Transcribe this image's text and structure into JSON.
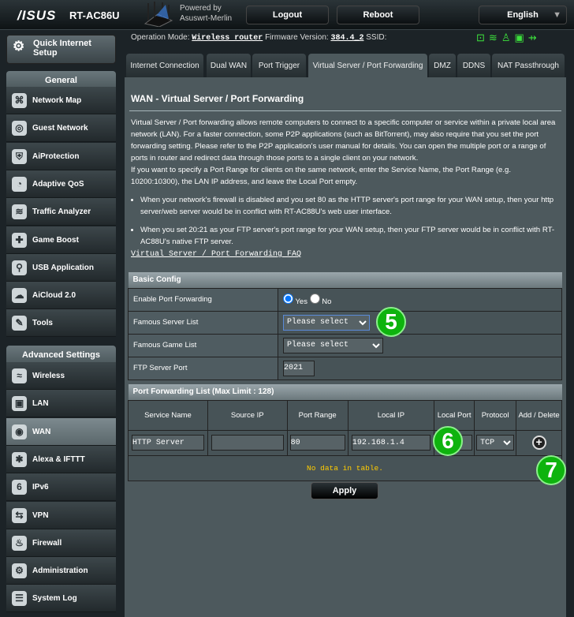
{
  "header": {
    "brand": "/ISUS",
    "model": "RT-AC86U",
    "powered_by": "Powered by",
    "firmware_brand": "Asuswrt-Merlin",
    "logout": "Logout",
    "reboot": "Reboot",
    "language": "English"
  },
  "status_bar": {
    "op_mode_label": "Operation Mode:",
    "op_mode": "Wireless router",
    "fw_label": "Firmware Version:",
    "fw": "384.4_2",
    "ssid_label": "SSID:",
    "icons": [
      "gamepad-icon",
      "wifi-icon",
      "user-icon",
      "device-icon",
      "usb-icon"
    ]
  },
  "sidebar": {
    "quick_setup": "Quick Internet Setup",
    "general": "General",
    "general_items": [
      {
        "label": "Network Map",
        "icon": "⌘"
      },
      {
        "label": "Guest Network",
        "icon": "◎"
      },
      {
        "label": "AiProtection",
        "icon": "⛨"
      },
      {
        "label": "Adaptive QoS",
        "icon": "◔"
      },
      {
        "label": "Traffic Analyzer",
        "icon": "≋"
      },
      {
        "label": "Game Boost",
        "icon": "✚"
      },
      {
        "label": "USB Application",
        "icon": "⚲"
      },
      {
        "label": "AiCloud 2.0",
        "icon": "☁"
      },
      {
        "label": "Tools",
        "icon": "✎"
      }
    ],
    "advanced": "Advanced Settings",
    "advanced_items": [
      {
        "label": "Wireless",
        "icon": "≈"
      },
      {
        "label": "LAN",
        "icon": "▣"
      },
      {
        "label": "WAN",
        "icon": "◉",
        "selected": true
      },
      {
        "label": "Alexa & IFTTT",
        "icon": "✱"
      },
      {
        "label": "IPv6",
        "icon": "6"
      },
      {
        "label": "VPN",
        "icon": "⇆"
      },
      {
        "label": "Firewall",
        "icon": "♨"
      },
      {
        "label": "Administration",
        "icon": "⚙"
      },
      {
        "label": "System Log",
        "icon": "☰"
      }
    ]
  },
  "tabs": [
    "Internet Connection",
    "Dual WAN",
    "Port Trigger",
    "Virtual Server / Port Forwarding",
    "DMZ",
    "DDNS",
    "NAT Passthrough"
  ],
  "active_tab": "Virtual Server / Port Forwarding",
  "page": {
    "title": "WAN - Virtual Server / Port Forwarding",
    "desc1": "Virtual Server / Port forwarding allows remote computers to connect to a specific computer or service within a private local area network (LAN). For a faster connection, some P2P applications (such as BitTorrent), may also require that you set the port forwarding setting. Please refer to the P2P application's user manual for details. You can open the multiple port or a range of ports in router and redirect data through those ports to a single client on your network.",
    "desc2": "If you want to specify a Port Range for clients on the same network, enter the Service Name, the Port Range (e.g. 10200:10300), the LAN IP address, and leave the Local Port empty.",
    "bullet1": "When your network's firewall is disabled and you set 80 as the HTTP server's port range for your WAN setup, then your http server/web server would be in conflict with RT-AC88U's web user interface.",
    "bullet2": "When you set 20:21 as your FTP server's port range for your WAN setup, then your FTP server would be in conflict with RT-AC88U's native FTP server.",
    "faq": "Virtual Server / Port Forwarding FAQ"
  },
  "basic": {
    "header": "Basic Config",
    "enable_label": "Enable Port Forwarding",
    "yes": "Yes",
    "no": "No",
    "enabled": "Yes",
    "server_label": "Famous Server List",
    "server_value": "Please select",
    "game_label": "Famous Game List",
    "game_value": "Please select",
    "ftp_label": "FTP Server Port",
    "ftp_value": "2021"
  },
  "pf": {
    "header": "Port Forwarding List (Max Limit : 128)",
    "columns": [
      "Service Name",
      "Source IP",
      "Port Range",
      "Local IP",
      "Local Port",
      "Protocol",
      "Add / Delete"
    ],
    "row": {
      "service": "HTTP Server",
      "source": "",
      "range": "80",
      "local_ip": "192.168.1.4",
      "local_port": "",
      "protocol": "TCP"
    },
    "empty": "No data in table."
  },
  "apply": "Apply",
  "annotations": [
    "5",
    "6",
    "7"
  ],
  "colors": {
    "panel": "#4d595d",
    "accent_green": "#0eb30e",
    "no_data": "#ffcc00"
  }
}
